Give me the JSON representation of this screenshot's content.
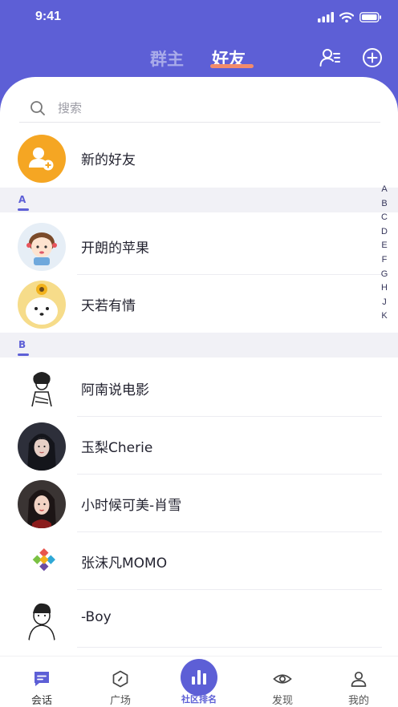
{
  "status_bar": {
    "time": "9:41"
  },
  "header": {
    "tabs": [
      {
        "label": "群主",
        "active": false
      },
      {
        "label": "好友",
        "active": true
      }
    ],
    "actions": [
      "contacts-list-icon",
      "add-circle-icon"
    ]
  },
  "search": {
    "placeholder": "搜索"
  },
  "new_friends": {
    "label": "新的好友",
    "icon": "person-add-icon"
  },
  "sections": [
    {
      "letter": "A",
      "contacts": [
        {
          "name": "开朗的苹果"
        },
        {
          "name": "天若有情"
        }
      ]
    },
    {
      "letter": "B",
      "contacts": [
        {
          "name": "阿南说电影"
        },
        {
          "name": "玉梨Cherie"
        },
        {
          "name": "小时候可美-肖雪"
        },
        {
          "name": "张沫凡MOMO"
        },
        {
          "name": "-Boy"
        }
      ]
    }
  ],
  "index_letters": [
    "A",
    "B",
    "C",
    "D",
    "E",
    "F",
    "G",
    "H",
    "J",
    "K"
  ],
  "bottom_nav": [
    {
      "label": "会话",
      "icon": "chat-icon",
      "active": true
    },
    {
      "label": "广场",
      "icon": "hexagon-icon",
      "active": false
    },
    {
      "label": "社区排名",
      "icon": "bar-chart-icon",
      "active": false
    },
    {
      "label": "发现",
      "icon": "eye-icon",
      "active": false
    },
    {
      "label": "我的",
      "icon": "user-icon",
      "active": false
    }
  ],
  "colors": {
    "primary": "#5d5fd6",
    "accent": "#f28b6c",
    "orange": "#f5a623"
  }
}
